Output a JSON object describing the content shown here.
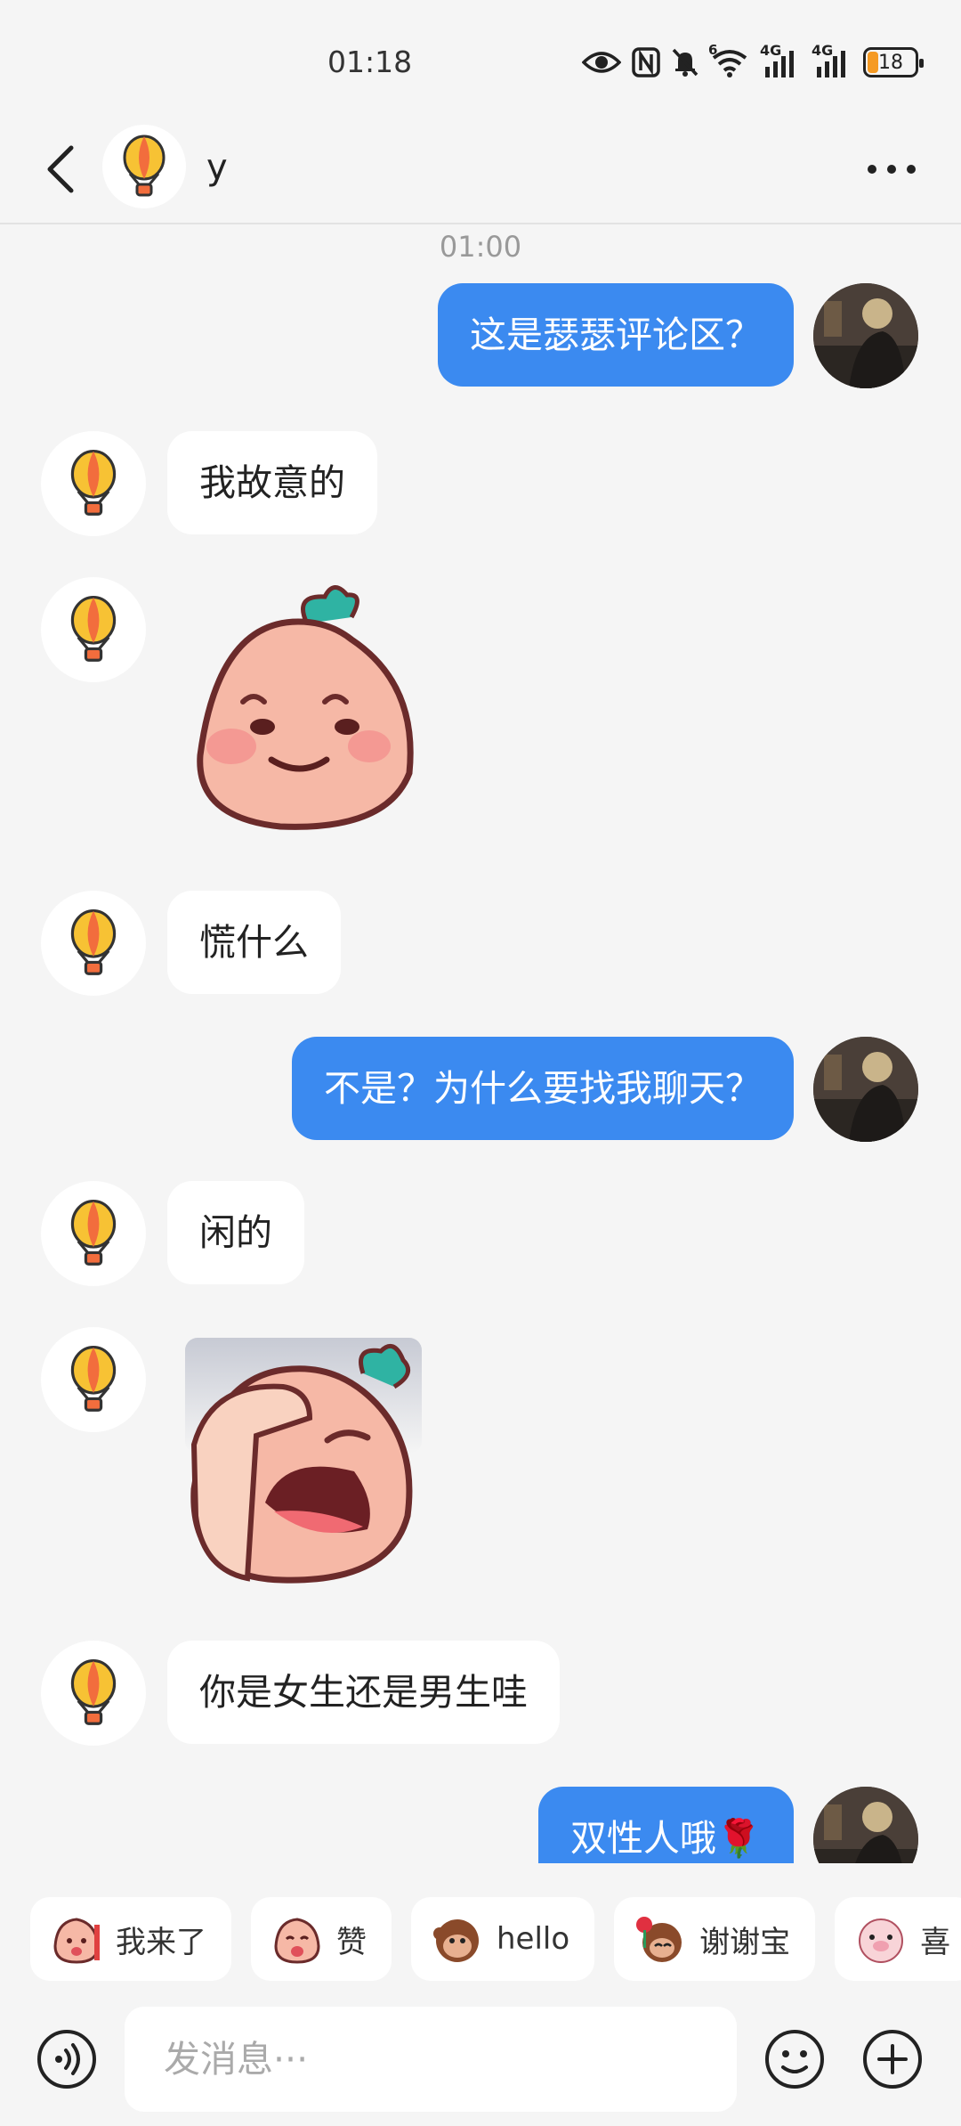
{
  "status_bar": {
    "time": "01:18",
    "battery": "18",
    "net_label_1": "4G",
    "net_label_2": "4G",
    "wifi_badge": "6"
  },
  "header": {
    "contact_name": "y"
  },
  "chat": {
    "timestamp": "01:00",
    "messages": [
      {
        "from": "me",
        "type": "text",
        "text": "这是瑟瑟评论区？"
      },
      {
        "from": "other",
        "type": "text",
        "text": "我故意的"
      },
      {
        "from": "other",
        "type": "sticker",
        "sticker": "smiling-peach"
      },
      {
        "from": "other",
        "type": "text",
        "text": "慌什么"
      },
      {
        "from": "me",
        "type": "text",
        "text": "不是？为什么要找我聊天？"
      },
      {
        "from": "other",
        "type": "text",
        "text": "闲的"
      },
      {
        "from": "other",
        "type": "sticker",
        "sticker": "facepalm-peach"
      },
      {
        "from": "other",
        "type": "text",
        "text": "你是女生还是男生哇"
      },
      {
        "from": "me",
        "type": "text",
        "text": "双性人哦🌹"
      }
    ]
  },
  "quick_replies": [
    "我来了",
    "赞",
    "hello",
    "谢谢宝",
    "喜"
  ],
  "input": {
    "placeholder": "发消息···"
  },
  "colors": {
    "outgoing_bubble": "#3b8af0",
    "incoming_bubble": "#ffffff",
    "background": "#f5f5f5"
  }
}
